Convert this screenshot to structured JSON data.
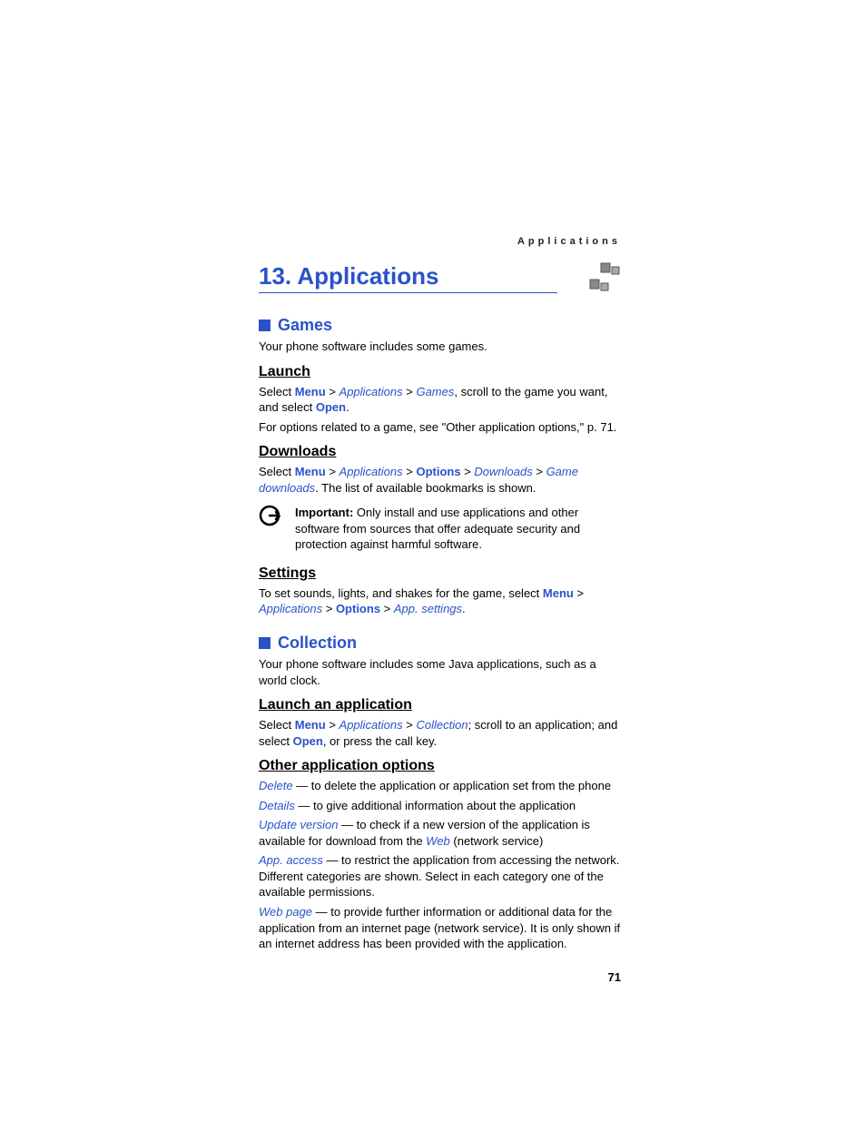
{
  "running_head": "Applications",
  "chapter_title": "13. Applications",
  "games": {
    "heading": "Games",
    "intro": "Your phone software includes some games.",
    "launch": {
      "heading": "Launch",
      "select": "Select ",
      "menu": "Menu",
      "sep": " > ",
      "applications": "Applications",
      "games": "Games",
      "rest": ", scroll to the game you want, and select ",
      "open": "Open",
      "period": ".",
      "options_note": "For options related to a game, see \"Other application options,\" p. 71."
    },
    "downloads": {
      "heading": "Downloads",
      "select": "Select ",
      "menu": "Menu",
      "sep": " > ",
      "applications": "Applications",
      "options": "Options",
      "downloads": "Downloads",
      "game_downloads": "Game downloads",
      "rest": ". The list of available bookmarks is shown.",
      "important_label": "Important: ",
      "important_text": "Only install and use applications and other software from sources that offer adequate security and protection against harmful software."
    },
    "settings": {
      "heading": "Settings",
      "pre": "To set sounds, lights, and shakes for the game, select ",
      "menu": "Menu",
      "sep": " > ",
      "applications": "Applications",
      "options": "Options",
      "app_settings": "App. settings",
      "period": "."
    }
  },
  "collection": {
    "heading": "Collection",
    "intro": "Your phone software includes some Java applications, such as a world clock.",
    "launch": {
      "heading": "Launch an application",
      "select": "Select ",
      "menu": "Menu",
      "sep": " > ",
      "applications": "Applications",
      "collection": "Collection",
      "rest": "; scroll to an application; and select ",
      "open": "Open",
      "tail": ", or press the call key."
    },
    "other": {
      "heading": "Other application options",
      "delete_label": "Delete",
      "delete_text": " — to delete the application or application set from the phone",
      "details_label": "Details",
      "details_text": " — to give additional information about the application",
      "update_label": "Update version",
      "update_text_a": " — to check if a new version of the application is available for download from the ",
      "web": "Web",
      "update_text_b": " (network service)",
      "access_label": "App. access",
      "access_text": " — to restrict the application from accessing the network. Different categories are shown. Select in each category one of the available permissions.",
      "webpage_label": "Web page",
      "webpage_text": " — to provide further information or additional data for the application from an internet page (network service). It is only shown if an internet address has been provided with the application."
    }
  },
  "page_number": "71"
}
